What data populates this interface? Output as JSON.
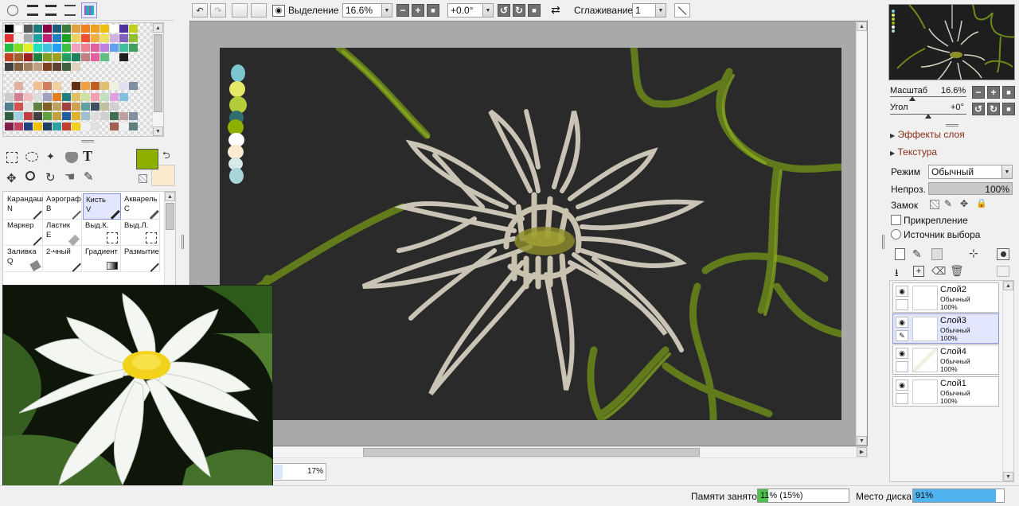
{
  "toolbar": {
    "selection_label": "Выделение",
    "zoom_value": "16.6%",
    "angle_value": "+0.0°",
    "smoothing_label": "Сглаживание",
    "smoothing_value": "1"
  },
  "tools": {
    "items": [
      {
        "label": "Карандаш",
        "key": "N"
      },
      {
        "label": "Аэрограф",
        "key": "B"
      },
      {
        "label": "Кисть",
        "key": "V"
      },
      {
        "label": "Акварель",
        "key": "C"
      },
      {
        "label": "Маркер",
        "key": ""
      },
      {
        "label": "Ластик",
        "key": "E"
      },
      {
        "label": "Выд.К.",
        "key": ""
      },
      {
        "label": "Выд.Л.",
        "key": ""
      },
      {
        "label": "Заливка",
        "key": "Q"
      },
      {
        "label": "2-чный",
        "key": ""
      },
      {
        "label": "Градиент",
        "key": ""
      },
      {
        "label": "Размытие",
        "key": ""
      }
    ]
  },
  "colors": {
    "primary": "#8db000",
    "secondary": "#fdebd0",
    "canvas_bg": "#2a2a2a",
    "accent_select": "#e3e6ff",
    "progress_blue": "#4fb3f0"
  },
  "navigator": {
    "scale_label": "Масштаб",
    "scale_value": "16.6%",
    "angle_label": "Угол",
    "angle_value": "+0°"
  },
  "layer_panel": {
    "effects_label": "Эффекты слоя",
    "texture_label": "Текстура",
    "mode_label": "Режим",
    "mode_value": "Обычный",
    "opacity_label": "Непроз.",
    "opacity_value": "100%",
    "lock_label": "Замок",
    "clipping_label": "Прикрепление",
    "source_label": "Источник выбора"
  },
  "layers": [
    {
      "name": "Слой2",
      "mode": "Обычный",
      "opacity": "100%"
    },
    {
      "name": "Слой3",
      "mode": "Обычный",
      "opacity": "100%"
    },
    {
      "name": "Слой4",
      "mode": "Обычный",
      "opacity": "100%"
    },
    {
      "name": "Слой1",
      "mode": "Обычный",
      "opacity": "100%"
    }
  ],
  "document_tab": {
    "zoom": "17%",
    "zoom_fraction": 0.17
  },
  "status": {
    "memory_label": "Памяти занято",
    "memory_value": "11% (15%)",
    "memory_fraction": 0.11,
    "disk_label": "Место диска",
    "disk_value": "91%",
    "disk_fraction": 0.91
  }
}
